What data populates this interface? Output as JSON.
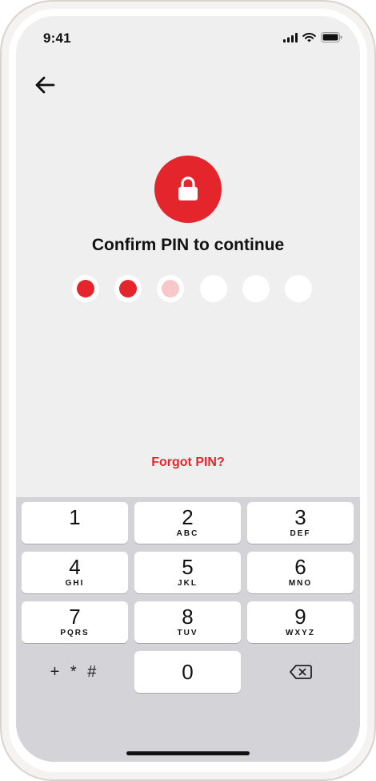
{
  "status_bar": {
    "time": "9:41",
    "icons": [
      "cellular-signal-icon",
      "wifi-icon",
      "battery-icon"
    ]
  },
  "navigation": {
    "back_icon": "arrow-left-icon"
  },
  "pin_screen": {
    "lock_icon": "lock-icon",
    "title": "Confirm PIN to continue",
    "pin_length": 6,
    "entered_count": 2,
    "pending_count": 1,
    "forgot_label": "Forgot PIN?"
  },
  "keypad": {
    "keys": [
      {
        "digit": "1",
        "letters": ""
      },
      {
        "digit": "2",
        "letters": "ABC"
      },
      {
        "digit": "3",
        "letters": "DEF"
      },
      {
        "digit": "4",
        "letters": "GHI"
      },
      {
        "digit": "5",
        "letters": "JKL"
      },
      {
        "digit": "6",
        "letters": "MNO"
      },
      {
        "digit": "7",
        "letters": "PQRS"
      },
      {
        "digit": "8",
        "letters": "TUV"
      },
      {
        "digit": "9",
        "letters": "WXYZ"
      },
      {
        "digit": "0",
        "letters": ""
      }
    ],
    "symbols_label": "+ * #",
    "delete_icon": "backspace-icon"
  },
  "colors": {
    "accent": "#e4262c",
    "pending": "#f7c7c9",
    "screen_bg": "#efefef",
    "keypad_bg": "#d3d3d8"
  }
}
